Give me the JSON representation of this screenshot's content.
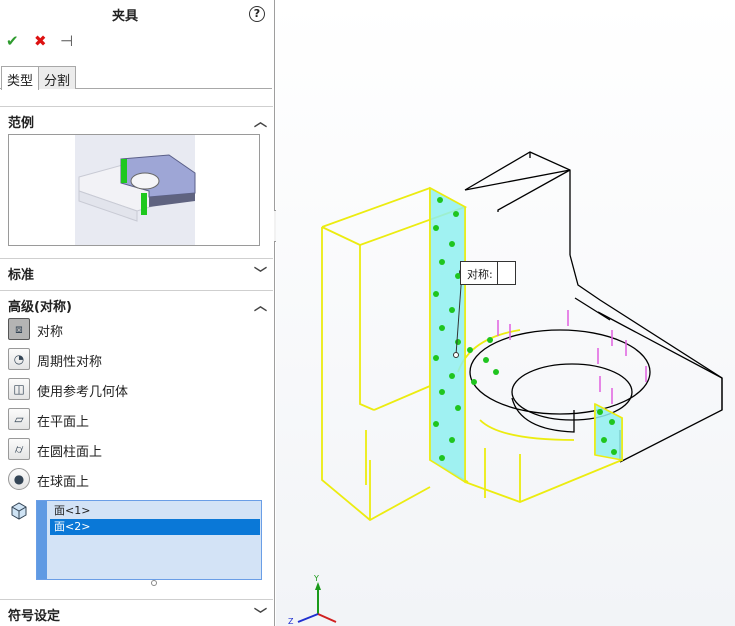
{
  "panel": {
    "title": "夹具",
    "help_glyph": "?",
    "actions": {
      "ok_glyph": "✔",
      "cancel_glyph": "✖",
      "pin_glyph": "⊣"
    },
    "tabs": [
      {
        "label": "类型",
        "active": true
      },
      {
        "label": "分割",
        "active": false
      }
    ],
    "sections": {
      "example": {
        "label": "范例",
        "expanded": true
      },
      "standard": {
        "label": "标准",
        "expanded": false
      },
      "advanced": {
        "label": "高级(对称)",
        "expanded": true
      },
      "symbol": {
        "label": "符号设定",
        "expanded": false
      }
    },
    "options": [
      {
        "label": "对称",
        "icon": "symmetry-icon",
        "selected": true
      },
      {
        "label": "周期性对称",
        "icon": "cyclic-symmetry-icon",
        "selected": false
      },
      {
        "label": "使用参考几何体",
        "icon": "reference-geometry-icon",
        "selected": false
      },
      {
        "label": "在平面上",
        "icon": "on-flat-face-icon",
        "selected": false
      },
      {
        "label": "在圆柱面上",
        "icon": "on-cylindrical-face-icon",
        "selected": false
      },
      {
        "label": "在球面上",
        "icon": "on-spherical-face-icon",
        "selected": false
      }
    ],
    "selection_list": {
      "icon": "face-icon",
      "items": [
        {
          "label": "面<1>",
          "highlighted": false
        },
        {
          "label": "面<2>",
          "highlighted": true
        }
      ]
    }
  },
  "viewport": {
    "callout_label": "对称:",
    "triad": {
      "y_label": "Y",
      "z_label": "Z"
    },
    "colors": {
      "edges": "#000000",
      "highlight": "#f0f000",
      "selected_face": "#8ff0f0",
      "arrows_green": "#1fc51f",
      "arrows_magenta": "#e060e0"
    }
  }
}
